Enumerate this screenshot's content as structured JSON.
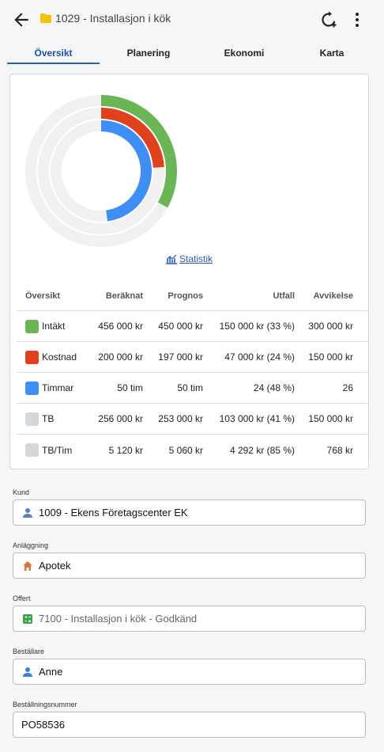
{
  "header": {
    "title": "1029 - Installasjon i kök",
    "colors": {
      "folder": "#f2c500"
    }
  },
  "tabs": [
    "Översikt",
    "Planering",
    "Ekonomi",
    "Karta"
  ],
  "chart_data": {
    "type": "pie",
    "variant": "concentric-donut",
    "series": [
      {
        "name": "Intäkt",
        "value_fraction": 0.33,
        "color": "#6ab655"
      },
      {
        "name": "Kostnad",
        "value_fraction": 0.24,
        "color": "#e0401a"
      },
      {
        "name": "Timmar",
        "value_fraction": 0.48,
        "color": "#3d8ef7"
      }
    ],
    "track_color": "#f1f1f1"
  },
  "statistics_link": "Statistik",
  "table": {
    "headers": [
      "Översikt",
      "Beräknat",
      "Prognos",
      "Utfall",
      "Avvikelse"
    ],
    "rows": [
      {
        "label": "Intäkt",
        "color": "#6ab655",
        "values": [
          "456 000 kr",
          "450 000 kr",
          "150 000 kr (33 %)",
          "300 000 kr"
        ]
      },
      {
        "label": "Kostnad",
        "color": "#e0401a",
        "values": [
          "200 000 kr",
          "197 000 kr",
          "47 000 kr (24 %)",
          "150 000 kr"
        ]
      },
      {
        "label": "Timmar",
        "color": "#3d8ef7",
        "values": [
          "50 tim",
          "50 tim",
          "24 (48 %)",
          "26"
        ]
      },
      {
        "label": "TB",
        "color": "#d3d6da",
        "values": [
          "256 000 kr",
          "253 000 kr",
          "103 000 kr (41 %)",
          "150 000 kr"
        ]
      },
      {
        "label": "TB/Tim",
        "color": "#d3d6da",
        "values": [
          "5 120 kr",
          "5 060 kr",
          "4 292 kr (85 %)",
          "768 kr"
        ]
      }
    ]
  },
  "fields": [
    {
      "label": "Kund",
      "value": "1009 - Ekens Företagscenter EK",
      "icon": "person-icon"
    },
    {
      "label": "Anläggning",
      "value": "Apotek",
      "icon": "home-icon"
    },
    {
      "label": "Offert",
      "value": "7100 - Installasjon i kök - Godkänd",
      "icon": "calculator-icon"
    },
    {
      "label": "Beställare",
      "value": "Anne",
      "icon": "person-icon"
    },
    {
      "label": "Beställningsnummer",
      "value": "PO58536",
      "icon": ""
    }
  ]
}
